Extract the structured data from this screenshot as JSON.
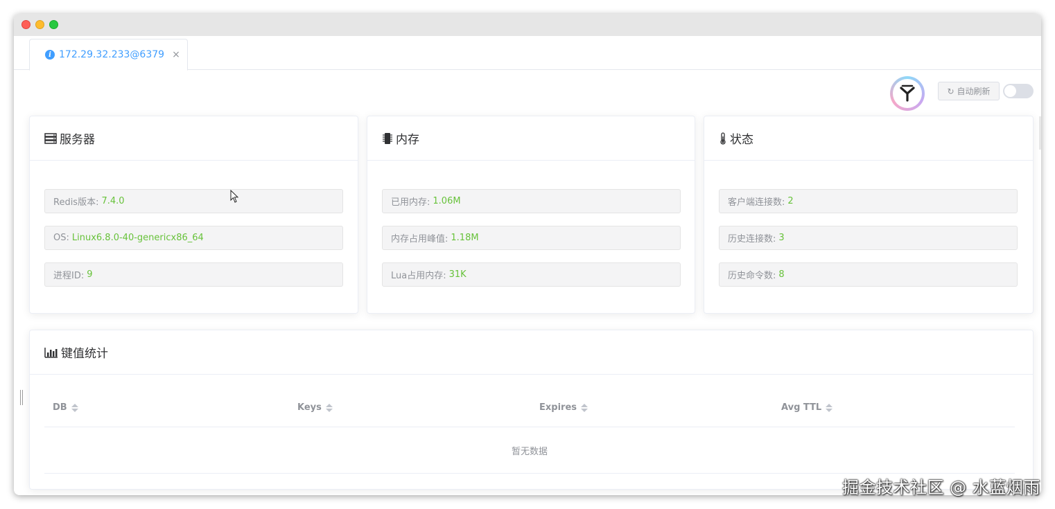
{
  "tab": {
    "label": "172.29.32.233@6379",
    "close": "×"
  },
  "toolbar": {
    "refresh_label": "自动刷新",
    "auto_refresh_on": false
  },
  "server": {
    "title": "服务器",
    "items": [
      {
        "label": "Redis版本:",
        "value": "7.4.0"
      },
      {
        "label": "OS:",
        "value": "Linux6.8.0-40-genericx86_64"
      },
      {
        "label": "进程ID:",
        "value": "9"
      }
    ]
  },
  "memory": {
    "title": "内存",
    "items": [
      {
        "label": "已用内存:",
        "value": "1.06M"
      },
      {
        "label": "内存占用峰值:",
        "value": "1.18M"
      },
      {
        "label": "Lua占用内存:",
        "value": "31K"
      }
    ]
  },
  "status": {
    "title": "状态",
    "items": [
      {
        "label": "客户端连接数:",
        "value": "2"
      },
      {
        "label": "历史连接数:",
        "value": "3"
      },
      {
        "label": "历史命令数:",
        "value": "8"
      }
    ]
  },
  "keystats": {
    "title": "键值统计",
    "columns": [
      "DB",
      "Keys",
      "Expires",
      "Avg TTL"
    ],
    "empty_text": "暂无数据"
  },
  "watermark": "掘金技术社区 @ 水蓝烟雨",
  "colors": {
    "accent": "#409eff",
    "value": "#67c23a",
    "muted": "#909399"
  }
}
